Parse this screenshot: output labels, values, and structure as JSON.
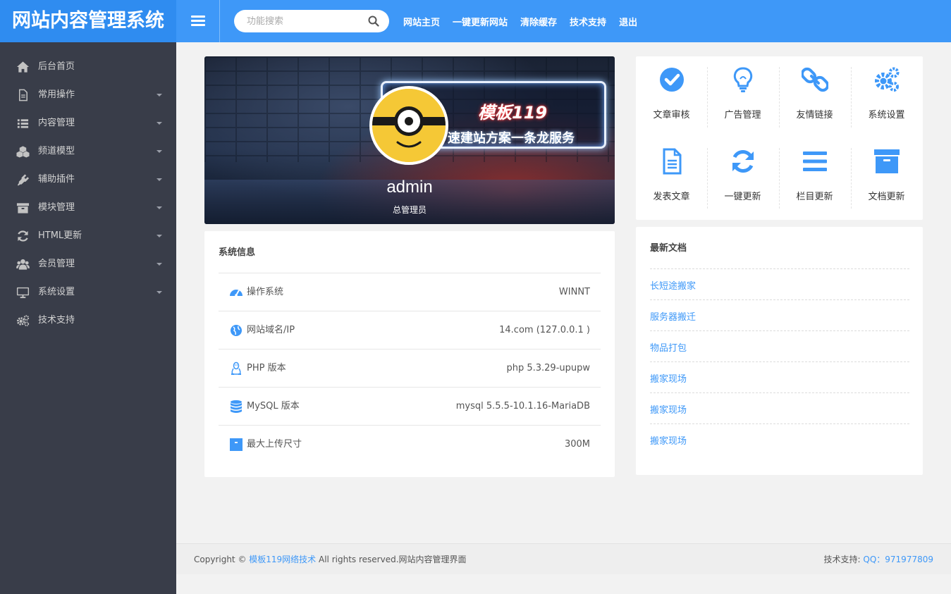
{
  "header": {
    "logo": "网站内容管理系统",
    "search_placeholder": "功能搜索",
    "nav": [
      "网站主页",
      "一键更新网站",
      "清除缓存",
      "技术支持",
      "退出"
    ]
  },
  "sidebar": {
    "items": [
      {
        "label": "后台首页",
        "icon": "home-icon",
        "has_submenu": false
      },
      {
        "label": "常用操作",
        "icon": "file-icon",
        "has_submenu": true
      },
      {
        "label": "内容管理",
        "icon": "list-icon",
        "has_submenu": true
      },
      {
        "label": "频道模型",
        "icon": "cubes-icon",
        "has_submenu": true
      },
      {
        "label": "辅助插件",
        "icon": "plug-icon",
        "has_submenu": true
      },
      {
        "label": "模块管理",
        "icon": "archive-icon",
        "has_submenu": true
      },
      {
        "label": "HTML更新",
        "icon": "refresh-icon",
        "has_submenu": true
      },
      {
        "label": "会员管理",
        "icon": "users-icon",
        "has_submenu": true
      },
      {
        "label": "系统设置",
        "icon": "desktop-icon",
        "has_submenu": true
      },
      {
        "label": "技术支持",
        "icon": "cogs-icon",
        "has_submenu": false
      }
    ]
  },
  "banner": {
    "brand": "模板119",
    "slogan": "速建站方案一条龙服务",
    "username": "admin",
    "role": "总管理员"
  },
  "sysinfo": {
    "title": "系统信息",
    "rows": [
      {
        "icon": "dashboard-icon",
        "label": "操作系统",
        "value": "WINNT"
      },
      {
        "icon": "globe-icon",
        "label": "网站域名/IP",
        "value": "14.com (127.0.0.1 )"
      },
      {
        "icon": "linux-icon",
        "label": "PHP 版本",
        "value": "php 5.3.29-upupw"
      },
      {
        "icon": "database-icon",
        "label": "MySQL 版本",
        "value": "mysql 5.5.5-10.1.16-MariaDB"
      },
      {
        "icon": "upload-box-icon",
        "label": "最大上传尺寸",
        "value": "300M"
      }
    ]
  },
  "quick": {
    "items": [
      {
        "label": "文章审核",
        "icon": "check-circle-icon"
      },
      {
        "label": "广告管理",
        "icon": "lightbulb-icon"
      },
      {
        "label": "友情链接",
        "icon": "link-icon"
      },
      {
        "label": "系统设置",
        "icon": "cogs-icon"
      },
      {
        "label": "发表文章",
        "icon": "document-icon"
      },
      {
        "label": "一键更新",
        "icon": "refresh-icon"
      },
      {
        "label": "栏目更新",
        "icon": "bars-icon"
      },
      {
        "label": "文档更新",
        "icon": "archive-icon"
      }
    ]
  },
  "recent": {
    "title": "最新文档",
    "links": [
      "长短途搬家",
      "服务器搬迁",
      "物品打包",
      "搬家现场",
      "搬家现场",
      "搬家现场"
    ]
  },
  "footer": {
    "copyright_prefix": "Copyright ©",
    "company": "模板119网络技术",
    "copyright_suffix": "All rights reserved.网站内容管理界面",
    "support_label": "技术支持:",
    "support_qq": "QQ：971977809"
  },
  "colors": {
    "accent": "#3e98f8",
    "sidebar_bg": "#393d49",
    "page_bg": "#f2f2f2"
  }
}
